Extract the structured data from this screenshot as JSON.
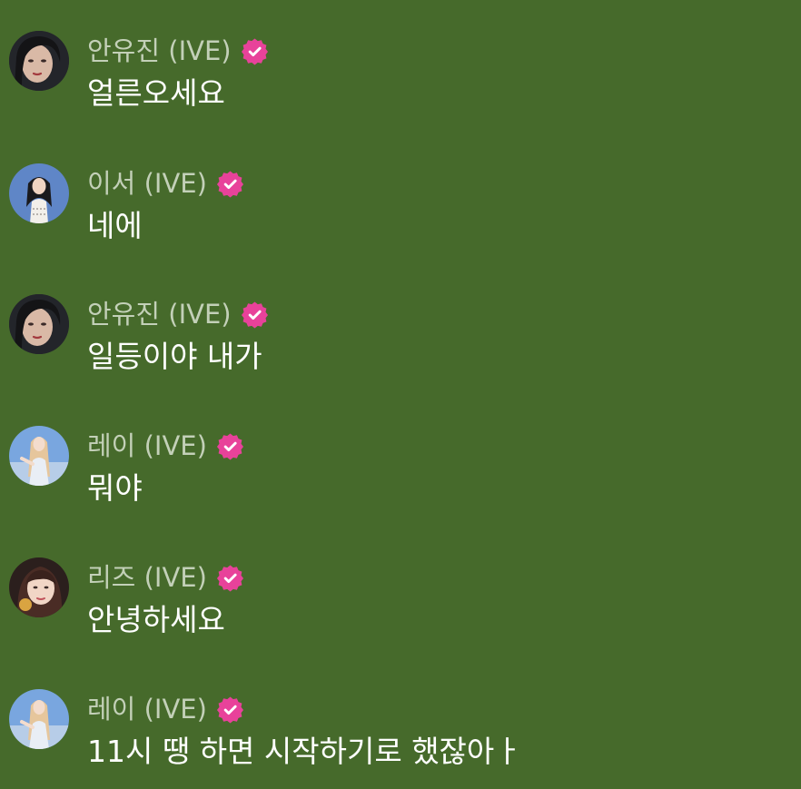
{
  "colors": {
    "background": "#466a2b",
    "author_name": "#c3d0b8",
    "message_text": "#ffffff",
    "verified_badge": "#e8429a"
  },
  "icons": {
    "verified": "verified-badge-icon"
  },
  "messages": [
    {
      "author": "안유진 (IVE)",
      "text": "얼른오세요",
      "verified": true,
      "avatar": "avatar-anyujin"
    },
    {
      "author": "이서 (IVE)",
      "text": "네에",
      "verified": true,
      "avatar": "avatar-leeseo"
    },
    {
      "author": "안유진 (IVE)",
      "text": "일등이야 내가",
      "verified": true,
      "avatar": "avatar-anyujin"
    },
    {
      "author": "레이 (IVE)",
      "text": "뭐야",
      "verified": true,
      "avatar": "avatar-rei"
    },
    {
      "author": "리즈 (IVE)",
      "text": "안녕하세요",
      "verified": true,
      "avatar": "avatar-liz"
    },
    {
      "author": "레이 (IVE)",
      "text": "11시 땡 하면 시작하기로 했잖아ㅏ",
      "verified": true,
      "avatar": "avatar-rei"
    }
  ]
}
